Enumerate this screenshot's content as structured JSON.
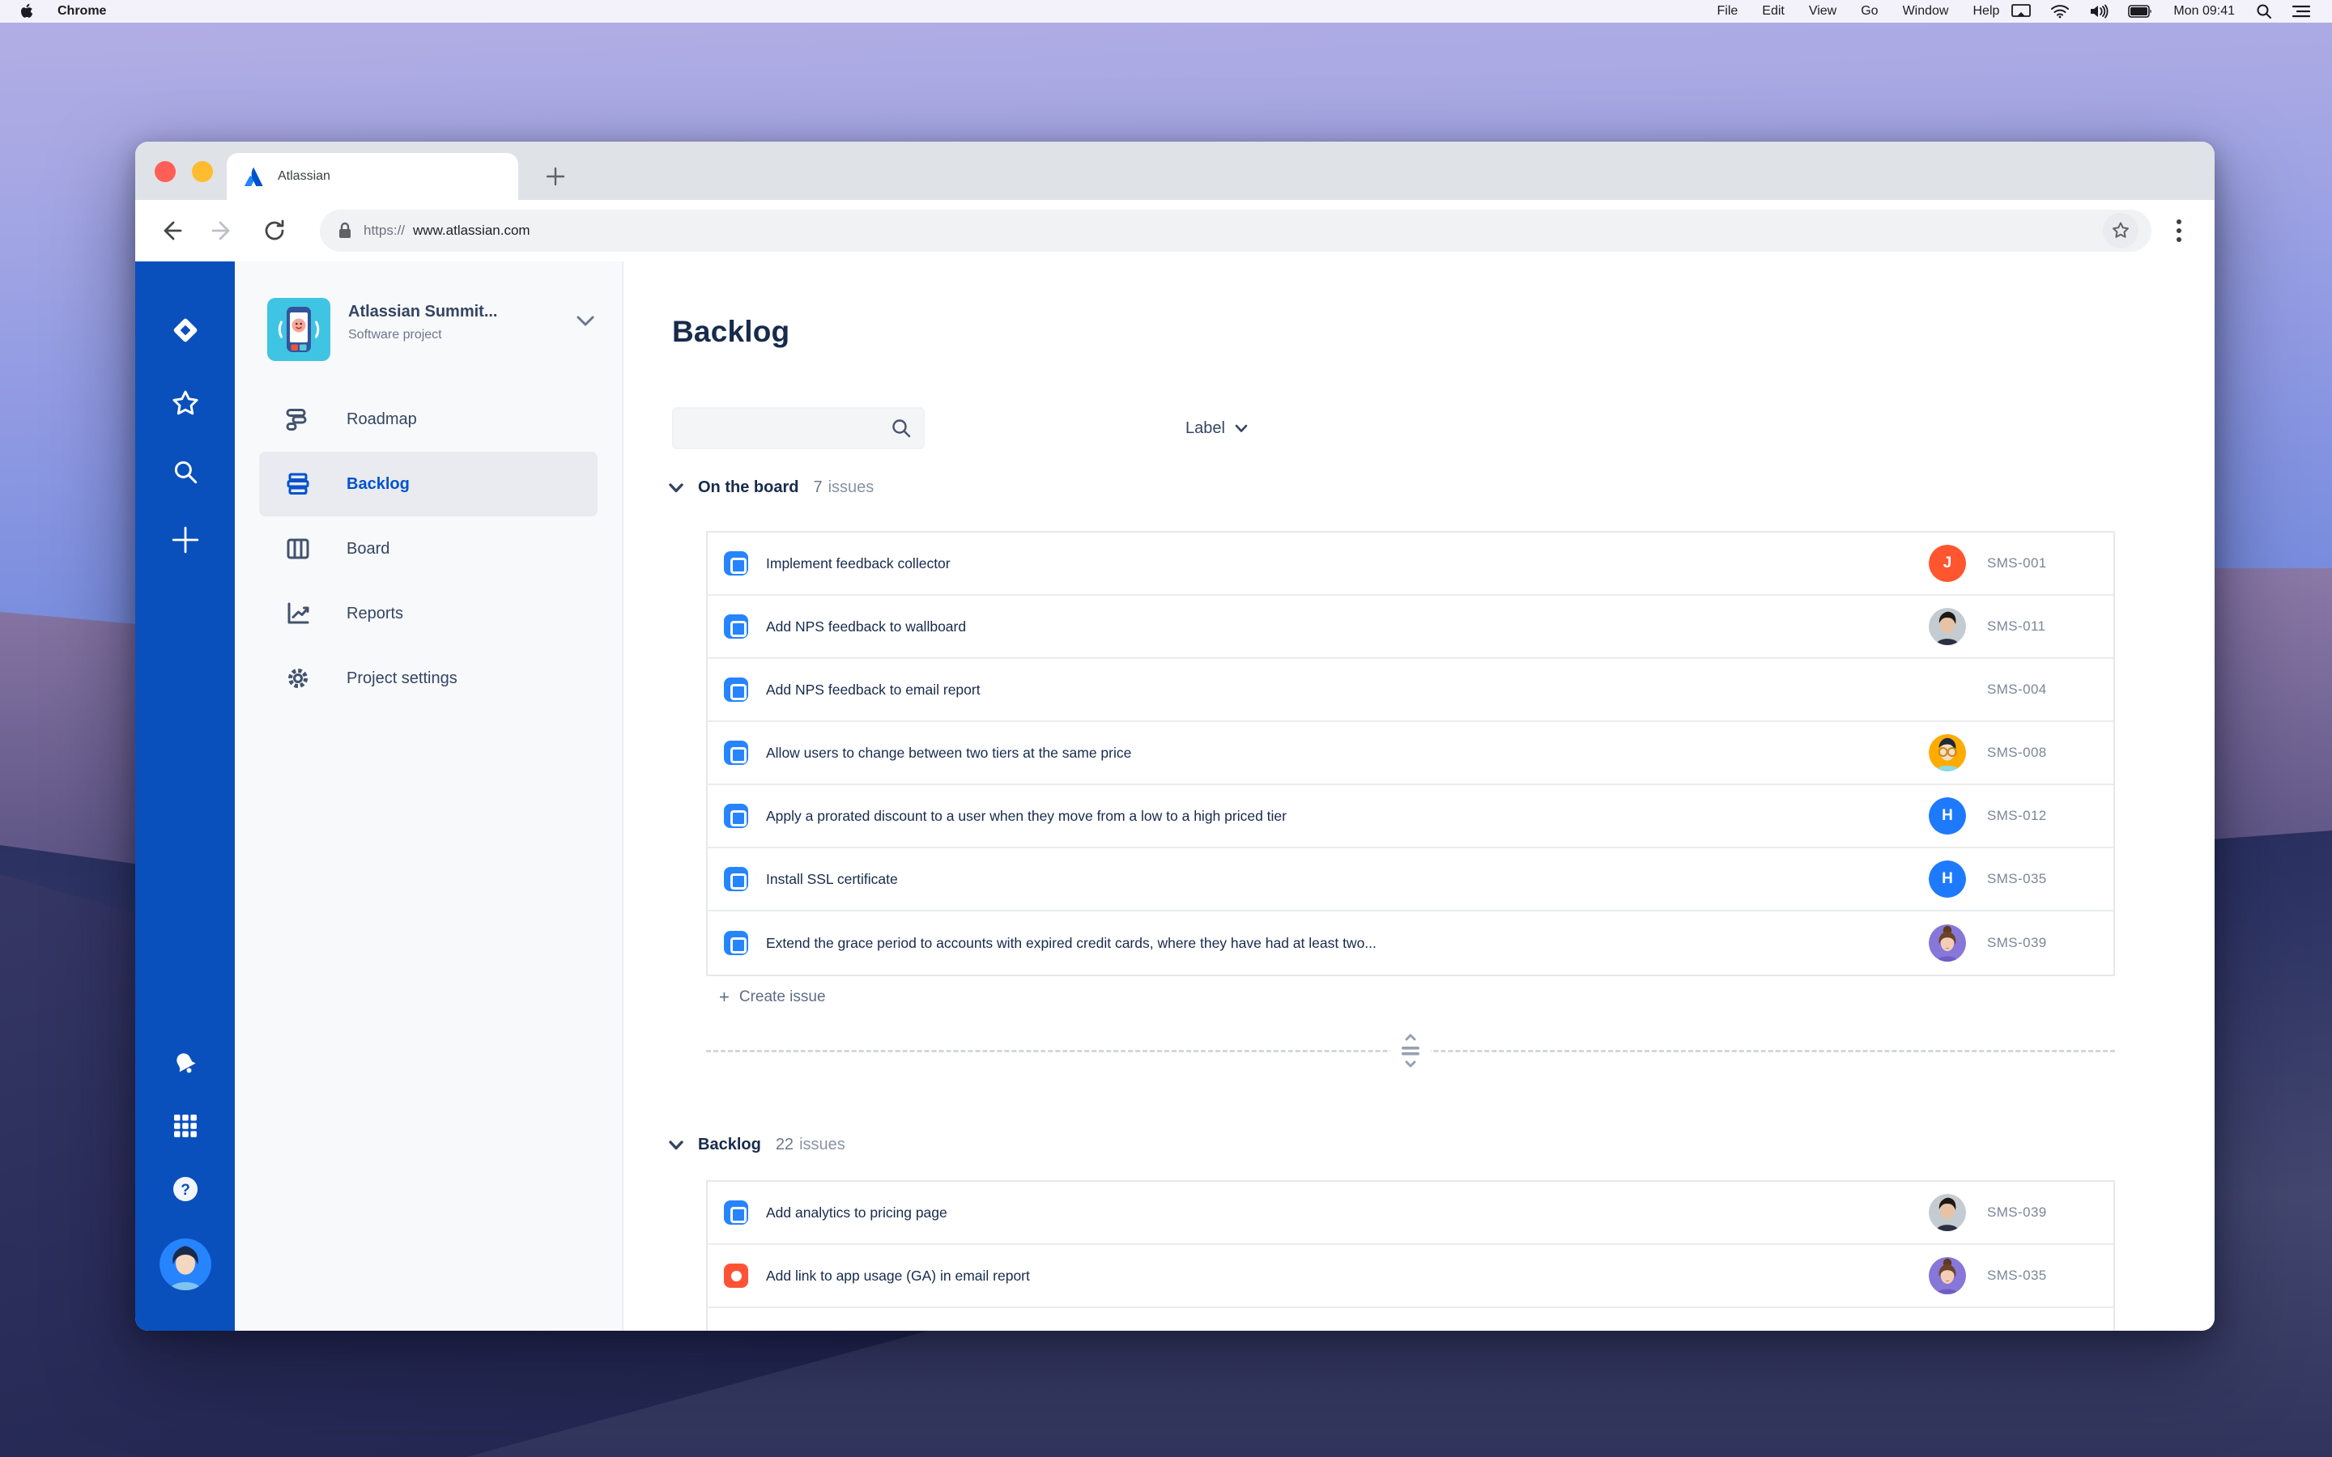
{
  "menu_bar": {
    "app": "Chrome",
    "items": [
      "File",
      "Edit",
      "View",
      "Go",
      "Window",
      "Help"
    ],
    "clock": "Mon 09:41"
  },
  "browser": {
    "tab_title": "Atlassian",
    "url_scheme": "https://",
    "url_host": "www.atlassian.com"
  },
  "sidebar": {
    "project_name": "Atlassian Summit...",
    "project_type": "Software project",
    "nav": [
      {
        "label": "Roadmap",
        "icon": "roadmap",
        "active": false
      },
      {
        "label": "Backlog",
        "icon": "backlog",
        "active": true
      },
      {
        "label": "Board",
        "icon": "board",
        "active": false
      },
      {
        "label": "Reports",
        "icon": "reports",
        "active": false
      },
      {
        "label": "Project settings",
        "icon": "settings",
        "active": false
      }
    ]
  },
  "main": {
    "title": "Backlog",
    "filter_label": "Label",
    "search_placeholder": "",
    "avatars": [
      {
        "kind": "orange-man"
      },
      {
        "kind": "initial",
        "color": "#1D7AFC",
        "letter": "H"
      },
      {
        "kind": "purple-woman"
      },
      {
        "kind": "initial",
        "color": "#FF5630",
        "letter": "J"
      },
      {
        "kind": "photo-man"
      },
      {
        "kind": "plus"
      }
    ],
    "create_issue_plus": "+",
    "create_issue": "Create issue",
    "sections": [
      {
        "title": "On the board",
        "count": "7",
        "count_label": "issues",
        "issues": [
          {
            "type": "story",
            "title": "Implement feedback collector",
            "key": "SMS-001",
            "avatar": {
              "kind": "initial",
              "color": "#FF5630",
              "letter": "J"
            }
          },
          {
            "type": "story",
            "title": "Add NPS feedback to wallboard",
            "key": "SMS-011",
            "avatar": {
              "kind": "photo-man"
            }
          },
          {
            "type": "story",
            "title": "Add NPS feedback to email report",
            "key": "SMS-004",
            "avatar": null
          },
          {
            "type": "story",
            "title": "Allow users to change between two tiers at the same price",
            "key": "SMS-008",
            "avatar": {
              "kind": "orange-man"
            }
          },
          {
            "type": "story",
            "title": "Apply a prorated discount to a user when they move from a low to a high priced tier",
            "key": "SMS-012",
            "avatar": {
              "kind": "initial",
              "color": "#1D7AFC",
              "letter": "H"
            }
          },
          {
            "type": "story",
            "title": "Install SSL certificate",
            "key": "SMS-035",
            "avatar": {
              "kind": "initial",
              "color": "#1D7AFC",
              "letter": "H"
            }
          },
          {
            "type": "story",
            "title": "Extend the grace period to accounts with expired credit cards, where they have had at least two...",
            "key": "SMS-039",
            "avatar": {
              "kind": "purple-woman"
            }
          }
        ]
      },
      {
        "title": "Backlog",
        "count": "22",
        "count_label": "issues",
        "issues": [
          {
            "type": "story",
            "title": "Add analytics to pricing page",
            "key": "SMS-039",
            "avatar": {
              "kind": "photo-man"
            }
          },
          {
            "type": "bug",
            "title": "Add link to app usage (GA) in email report",
            "key": "SMS-035",
            "avatar": {
              "kind": "purple-woman"
            }
          }
        ]
      }
    ]
  },
  "colors": {
    "accent": "#0052CC",
    "rail": "#0A50BD",
    "story": "#2684FF",
    "bug": "#FF5336"
  }
}
